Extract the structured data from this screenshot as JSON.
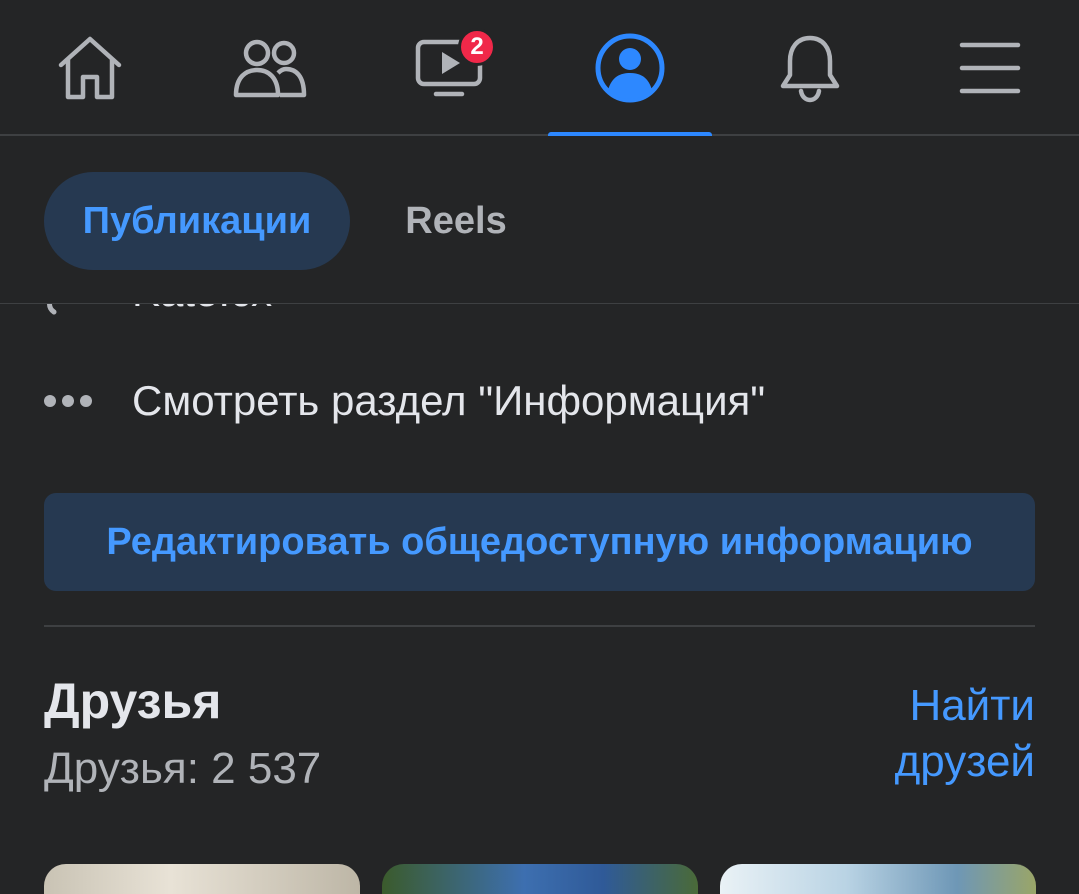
{
  "nav": {
    "items": [
      {
        "icon": "home-icon",
        "active": false
      },
      {
        "icon": "friends-icon",
        "active": false
      },
      {
        "icon": "video-icon",
        "active": false,
        "badge": "2"
      },
      {
        "icon": "profile-icon",
        "active": true
      },
      {
        "icon": "bell-icon",
        "active": false
      },
      {
        "icon": "menu-icon",
        "active": false
      }
    ]
  },
  "tabs": {
    "items": [
      {
        "label": "Публикации",
        "active": true
      },
      {
        "label": "Reels",
        "active": false
      }
    ]
  },
  "about": {
    "partial_link_text": "Kate.cx",
    "see_info_label": "Смотреть раздел \"Информация\""
  },
  "edit_button_label": "Редактировать общедоступную информацию",
  "friends": {
    "title": "Друзья",
    "count_label": "Друзья: 2 537",
    "find_label_line1": "Найти",
    "find_label_line2": "друзей"
  },
  "colors": {
    "background": "#242526",
    "accent": "#2d88ff",
    "accent_text": "#4599ff",
    "badge": "#f02849"
  }
}
